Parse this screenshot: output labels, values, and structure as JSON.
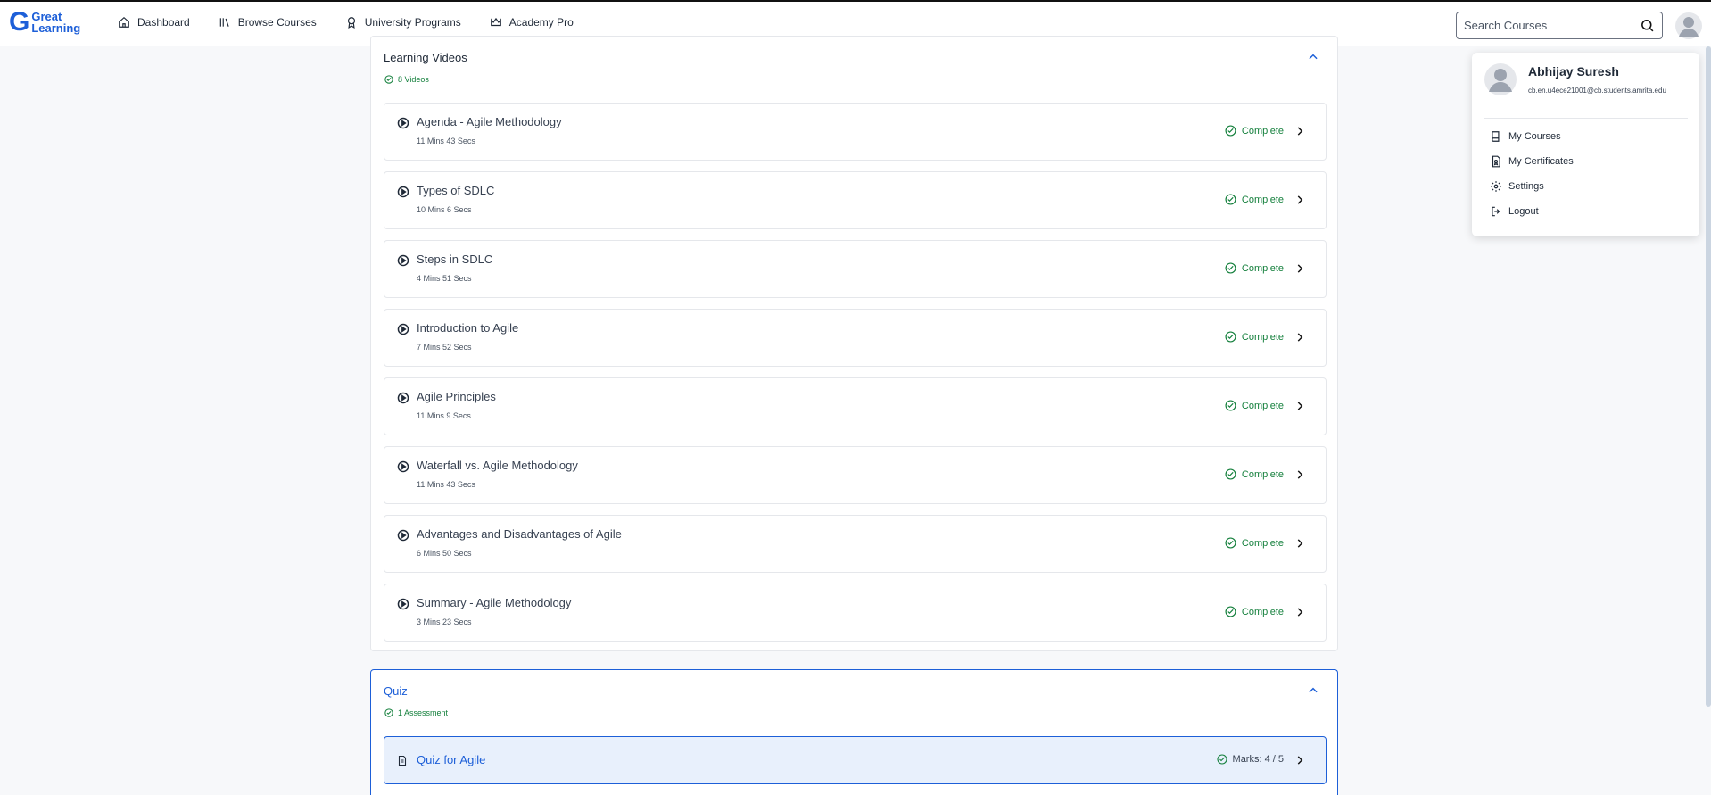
{
  "header": {
    "logo_line1": "Great",
    "logo_line2": "Learning",
    "nav": [
      {
        "label": "Dashboard",
        "icon": "home-icon"
      },
      {
        "label": "Browse Courses",
        "icon": "library-icon"
      },
      {
        "label": "University Programs",
        "icon": "award-icon"
      },
      {
        "label": "Academy Pro",
        "icon": "crown-icon"
      }
    ],
    "search_placeholder": "Search Courses"
  },
  "videos": {
    "title": "Learning Videos",
    "count_label": "8 Videos",
    "items": [
      {
        "title": "Agenda - Agile Methodology",
        "duration": "11 Mins 43 Secs",
        "status": "Complete"
      },
      {
        "title": "Types of SDLC",
        "duration": "10 Mins 6 Secs",
        "status": "Complete"
      },
      {
        "title": "Steps in SDLC",
        "duration": "4 Mins 51 Secs",
        "status": "Complete"
      },
      {
        "title": "Introduction to Agile",
        "duration": "7 Mins 52 Secs",
        "status": "Complete"
      },
      {
        "title": "Agile Principles",
        "duration": "11 Mins 9 Secs",
        "status": "Complete"
      },
      {
        "title": "Waterfall vs. Agile Methodology",
        "duration": "11 Mins 43 Secs",
        "status": "Complete"
      },
      {
        "title": "Advantages and Disadvantages of Agile",
        "duration": "6 Mins 50 Secs",
        "status": "Complete"
      },
      {
        "title": "Summary - Agile Methodology",
        "duration": "3 Mins 23 Secs",
        "status": "Complete"
      }
    ]
  },
  "quiz": {
    "title": "Quiz",
    "count_label": "1 Assessment",
    "item": {
      "title": "Quiz for Agile",
      "marks": "Marks: 4 / 5"
    }
  },
  "profile_menu": {
    "name": "Abhijay Suresh",
    "email": "cb.en.u4ece21001@cb.students.amrita.edu",
    "items": [
      {
        "label": "My Courses",
        "icon": "book-icon"
      },
      {
        "label": "My Certificates",
        "icon": "certificate-icon"
      },
      {
        "label": "Settings",
        "icon": "gear-icon"
      },
      {
        "label": "Logout",
        "icon": "logout-icon"
      }
    ]
  },
  "colors": {
    "brand": "#1d5fd8",
    "success": "#15803d",
    "quiz_bg": "#e8f0fc"
  }
}
